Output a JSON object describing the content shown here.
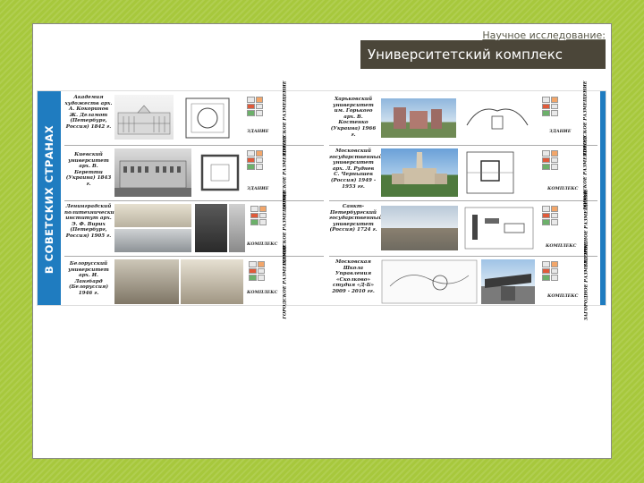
{
  "header": {
    "subtitle": "Научное исследование:",
    "title": "Университетский комплекс"
  },
  "poster": {
    "band_label": "В СОВЕТСКИХ СТРАНАХ",
    "left_rows": [
      {
        "caption": "Академия художеств арх. А. Кокоринов Ж. Деламот (Петербург, Россия) 1842 г.",
        "tag": "ЗДАНИЕ",
        "vlabel": "ГОРОДСКОЕ РАЗМЕЩЕНИЕ"
      },
      {
        "caption": "Киевский университет арх. В. Беретти (Украина) 1843 г.",
        "tag": "ЗДАНИЕ",
        "vlabel": "ГОРОДСКОЕ РАЗМЕЩЕНИЕ"
      },
      {
        "caption": "Ленинградский политехнический институт арх. Э. Ф. Вирих (Петербург, Россия) 1905 г.",
        "tag": "КОМПЛЕКС",
        "vlabel": "ГОРОДСКОЕ РАЗМЕЩЕНИЕ"
      },
      {
        "caption": "Белорусский университет арх. И. Лангбард (Белоруссия) 1946 г.",
        "tag": "КОМПЛЕКС",
        "vlabel": "ГОРОДСКОЕ РАЗМЕЩЕНИЕ"
      }
    ],
    "right_rows": [
      {
        "caption": "Харьковский университет им. Горького арх. В. Костенко (Украина) 1966 г.",
        "tag": "ЗДАНИЕ",
        "vlabel": "ГОРОДСКОЕ РАЗМЕЩЕНИЕ"
      },
      {
        "caption": "Московский государственный университет арх. Л. Руднев С. Чернышев (Россия) 1949 - 1953 гг.",
        "tag": "КОМПЛЕКС",
        "vlabel": "ГОРОДСКОЕ РАЗМЕЩЕНИЕ"
      },
      {
        "caption": "Санкт-Петербургский государственный университет (Россия) 1724 г.",
        "tag": "КОМПЛЕКС",
        "vlabel": "ЗАГОРОДНОЕ РАЗМЕЩЕНИЕ"
      },
      {
        "caption": "Московская Школа Управления «Сколково» студия «Д-Б» 2009 - 2010 гг.",
        "tag": "КОМПЛЕКС",
        "vlabel": "ЗАГОРОДНОЕ РАЗМЕЩЕНИЕ"
      }
    ]
  },
  "colors": {
    "background": "#a7c83c",
    "title_bar": "#4b4639",
    "band": "#1f7cc0"
  }
}
